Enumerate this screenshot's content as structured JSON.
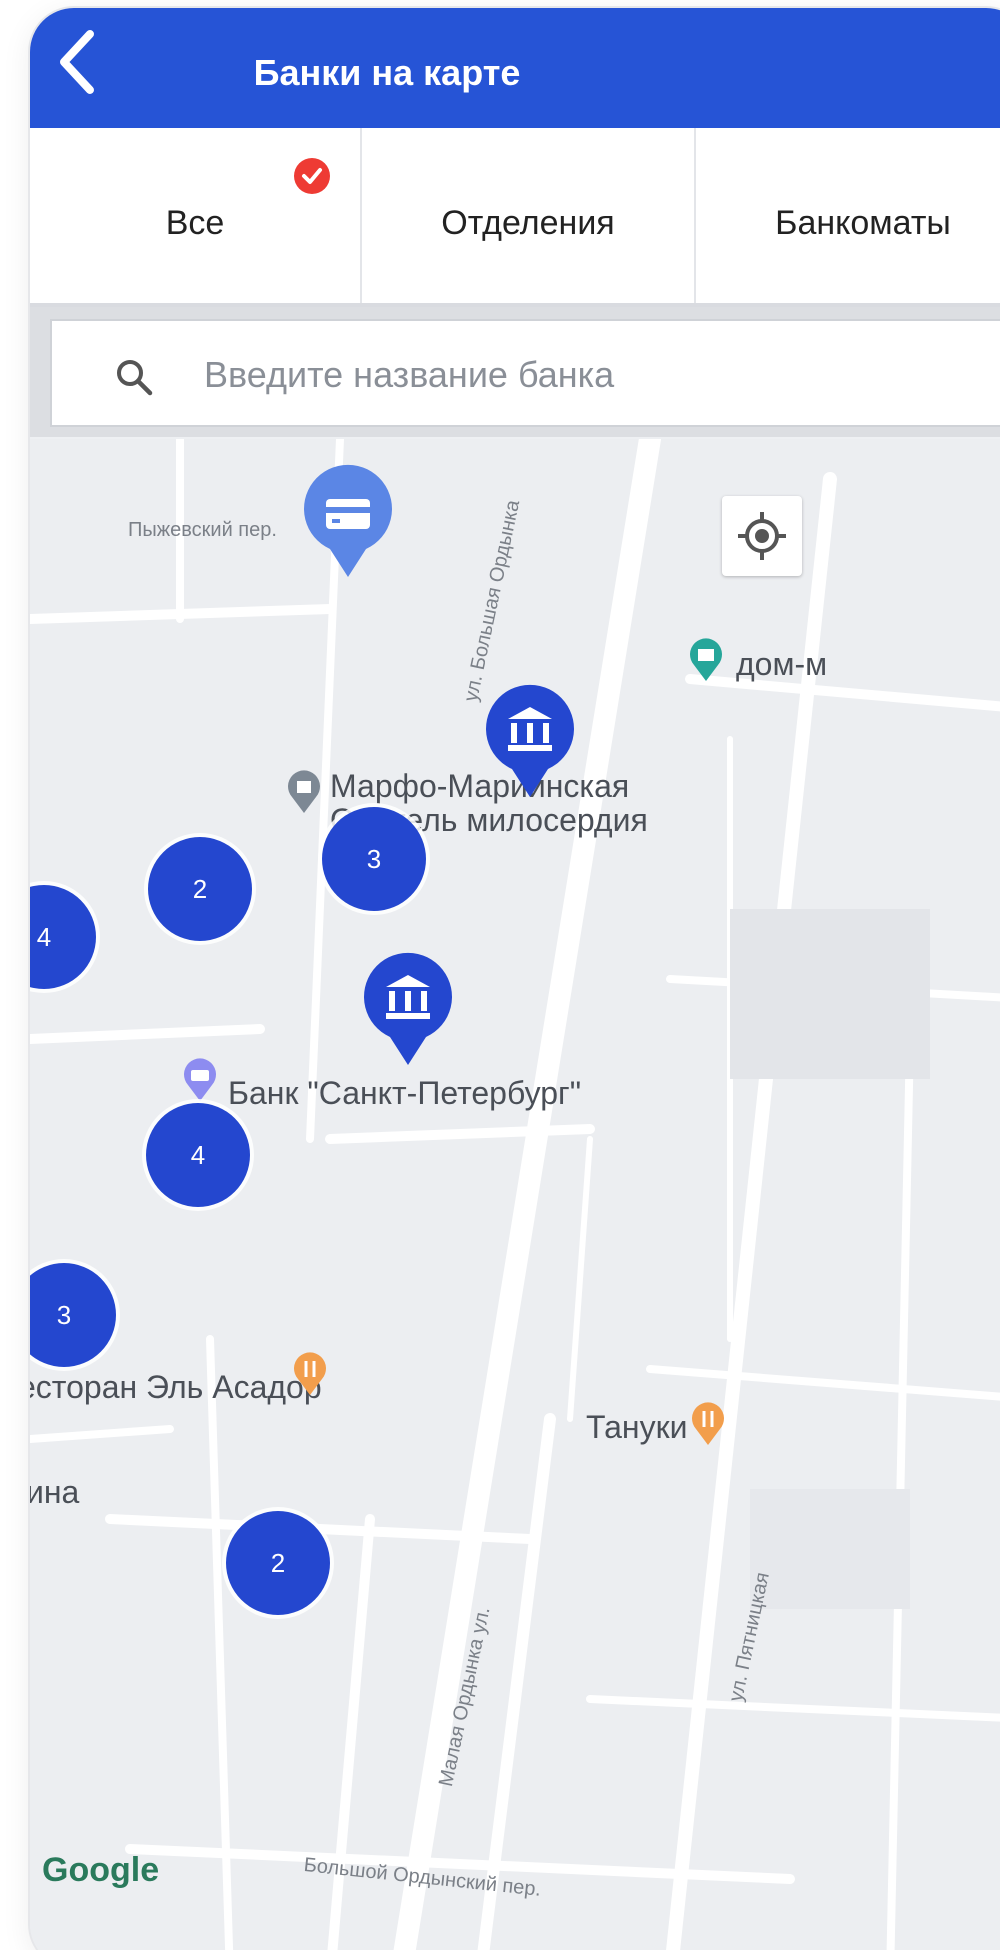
{
  "header": {
    "title": "Банки на карте"
  },
  "tabs": [
    {
      "label": "Все",
      "selected": true
    },
    {
      "label": "Отделения",
      "selected": false
    },
    {
      "label": "Банкоматы",
      "selected": false
    }
  ],
  "search": {
    "placeholder": "Введите название банка"
  },
  "map": {
    "street_labels": {
      "pyzhevsky": "Пыжевский пер.",
      "bolshaya_ordynka": "ул. Большая Ордынка",
      "malaya_ordynka": "Малая Ордынка ул.",
      "pyatnitskaya": "ул. Пятницкая",
      "bolshoy_ordynsky": "Большой Ордынский пер."
    },
    "poi_labels": {
      "marfo": "Марфо-Мариинская",
      "marfo_line2": "Обитель милосердия",
      "dom": "дом-м",
      "bank_spb": "Банк \"Санкт-Петербург\"",
      "restaurant": "есторан Эль Асадор",
      "tanuki": "Тануки",
      "ina": "ина"
    },
    "clusters": [
      "2",
      "3",
      "4",
      "4",
      "3",
      "2"
    ],
    "google": "Google"
  },
  "colors": {
    "header": "#2654d6",
    "cluster": "#2447cf",
    "atm_pin": "#5b86e5",
    "check_badge": "#ee3b34",
    "restaurant_poi": "#f29e4c",
    "museum_poi": "#26a69a"
  },
  "icons": {
    "back": "chevron-left-icon",
    "check": "check-circle-icon",
    "search": "search-icon",
    "locate": "crosshair-icon",
    "bank": "bank-building-icon",
    "card": "credit-card-icon"
  }
}
